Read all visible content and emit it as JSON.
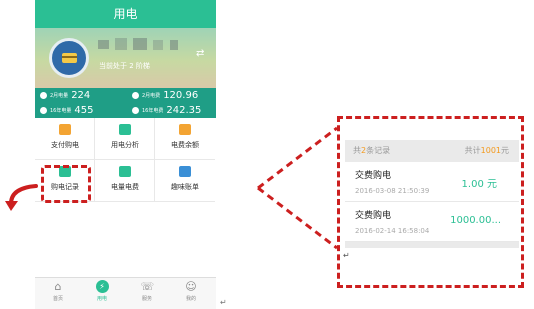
{
  "header": {
    "title": "用电"
  },
  "banner": {
    "floor_text": "当前处于 2 阶梯"
  },
  "stats": [
    {
      "label": "2月电量",
      "value": "224"
    },
    {
      "label": "2月电费",
      "value": "120.96"
    },
    {
      "label": "16年电量",
      "value": "455"
    },
    {
      "label": "16年电费",
      "value": "242.35"
    }
  ],
  "grid": [
    {
      "label": "支付购电",
      "icon": "wallet-icon",
      "color": "#f3a433"
    },
    {
      "label": "用电分析",
      "icon": "bar-chart-icon",
      "color": "#2bbf94"
    },
    {
      "label": "电费余额",
      "icon": "yen-coin-icon",
      "color": "#f3a433"
    },
    {
      "label": "购电记录",
      "icon": "record-icon",
      "color": "#2bbf94"
    },
    {
      "label": "电量电费",
      "icon": "meter-icon",
      "color": "#2bbf94"
    },
    {
      "label": "趣味账单",
      "icon": "bill-icon",
      "color": "#3a8fd6"
    }
  ],
  "tabbar": [
    {
      "label": "首页",
      "icon": "home-icon"
    },
    {
      "label": "用电",
      "icon": "power-icon"
    },
    {
      "label": "服务",
      "icon": "phone-icon"
    },
    {
      "label": "我的",
      "icon": "user-icon"
    }
  ],
  "detail": {
    "count_prefix": "共",
    "count": "2",
    "count_suffix": "条记录",
    "total_prefix": "共计",
    "total": "1001",
    "total_suffix": "元",
    "records": [
      {
        "title": "交费购电",
        "date": "2016-03-08 21:50:39",
        "amount": "1.00 元"
      },
      {
        "title": "交费购电",
        "date": "2016-02-14 16:58:04",
        "amount": "1000.00..."
      }
    ]
  },
  "marks": {
    "return_mark": "↵"
  },
  "colors": {
    "brand": "#2bbf94",
    "stats_bg": "#1f9e86",
    "annotation": "#cc1f1f",
    "accent": "#f39a1e"
  }
}
